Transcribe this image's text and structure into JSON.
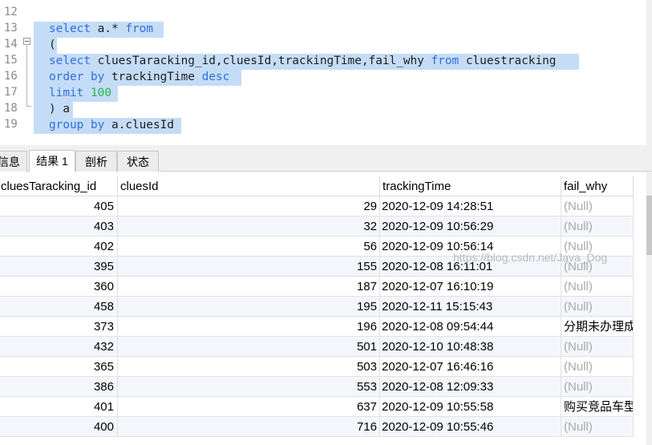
{
  "editor": {
    "line_numbers": [
      "12",
      "13",
      "14",
      "15",
      "16",
      "17",
      "18",
      "19"
    ],
    "lines": [
      [],
      [
        {
          "t": "select",
          "c": "kw"
        },
        {
          "t": " a.* "
        },
        {
          "t": "from",
          "c": "kw"
        }
      ],
      [
        {
          "t": "("
        }
      ],
      [
        {
          "t": "select",
          "c": "kw"
        },
        {
          "t": " cluesTaracking_id,cluesId,trackingTime,fail_why "
        },
        {
          "t": "from",
          "c": "kw"
        },
        {
          "t": " cluestracking"
        }
      ],
      [
        {
          "t": "order",
          "c": "kw"
        },
        {
          "t": " "
        },
        {
          "t": "by",
          "c": "kw"
        },
        {
          "t": " trackingTime "
        },
        {
          "t": "desc",
          "c": "kw"
        }
      ],
      [
        {
          "t": "limit",
          "c": "kw"
        },
        {
          "t": " "
        },
        {
          "t": "100",
          "c": "num"
        }
      ],
      [
        {
          "t": ") a"
        }
      ],
      [
        {
          "t": "group",
          "c": "kw"
        },
        {
          "t": " "
        },
        {
          "t": "by",
          "c": "kw"
        },
        {
          "t": " a.cluesId"
        }
      ]
    ]
  },
  "tabs": [
    "信息",
    "结果 1",
    "剖析",
    "状态"
  ],
  "grid": {
    "columns": [
      "cluesTaracking_id",
      "cluesId",
      "trackingTime",
      "fail_why"
    ],
    "rows": [
      [
        "405",
        "29",
        "2020-12-09 14:28:51",
        "(Null)"
      ],
      [
        "403",
        "32",
        "2020-12-09 10:56:29",
        "(Null)"
      ],
      [
        "402",
        "56",
        "2020-12-09 10:56:14",
        "(Null)"
      ],
      [
        "395",
        "155",
        "2020-12-08 16:11:01",
        "(Null)"
      ],
      [
        "360",
        "187",
        "2020-12-07 16:10:19",
        "(Null)"
      ],
      [
        "458",
        "195",
        "2020-12-11 15:15:43",
        "(Null)"
      ],
      [
        "373",
        "196",
        "2020-12-08 09:54:44",
        "分期未办理成"
      ],
      [
        "432",
        "501",
        "2020-12-10 10:48:38",
        "(Null)"
      ],
      [
        "365",
        "503",
        "2020-12-07 16:46:16",
        "(Null)"
      ],
      [
        "386",
        "553",
        "2020-12-08 12:09:33",
        "(Null)"
      ],
      [
        "401",
        "637",
        "2020-12-09 10:55:58",
        "购买竞品车型"
      ],
      [
        "400",
        "716",
        "2020-12-09 10:55:46",
        "(Null)"
      ]
    ],
    "null_text": "(Null)"
  },
  "watermark": "https://blog.csdn.net/Java_Dog",
  "colors": {
    "selection": "#c5dcf6",
    "keyword": "#2d6fdc",
    "number": "#26b54a",
    "null": "#a9a9a9",
    "row_alt": "#f4f6fb"
  }
}
